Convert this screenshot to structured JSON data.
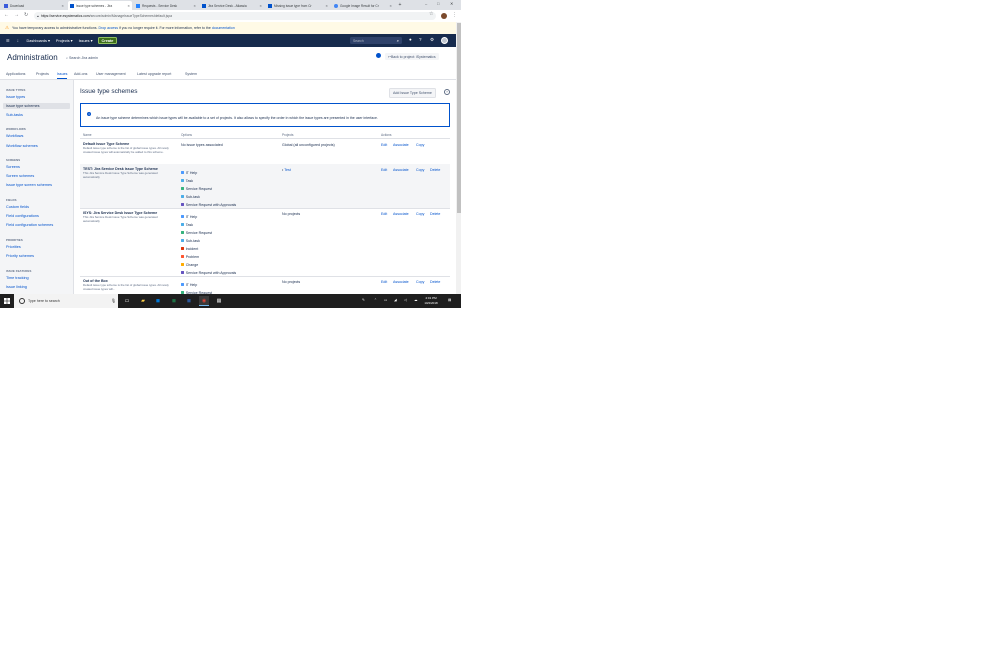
{
  "browser": {
    "tabs": [
      {
        "title": "Download",
        "color": "#3b5bdb",
        "active": false
      },
      {
        "title": "Issue type schemes - Jira",
        "color": "#0052cc",
        "active": true
      },
      {
        "title": "Requests - Service Desk",
        "color": "#2684ff",
        "active": false
      },
      {
        "title": "Jira Service Desk - Atlassia",
        "color": "#0052cc",
        "active": false
      },
      {
        "title": "Missing issue type from Cr",
        "color": "#0052cc",
        "active": false
      },
      {
        "title": "Google Image Result for Cr",
        "color": "#4285f4",
        "active": false
      }
    ],
    "url_host": "https://service.esystematics.com",
    "url_path": "/secure/admin/ManageIssueTypeSchemes!default.jspa"
  },
  "banner": {
    "text1": "You have temporary access to administrative functions.",
    "drop_link": "Drop access",
    "text2": "if you no longer require it. For more information, refer to the",
    "doc_link": "documentation"
  },
  "topnav": {
    "dashboards": "Dashboards ▾",
    "projects": "Projects ▾",
    "issues": "Issues ▾",
    "create": "Create",
    "search_placeholder": "Search"
  },
  "admin": {
    "title": "Administration",
    "search": "Search Jira admin",
    "back": "Back to project: iSystematics",
    "tabs": [
      "Applications",
      "Projects",
      "Issues",
      "Add-ons",
      "User management",
      "Latest upgrade report",
      "System"
    ]
  },
  "sidebar": {
    "sections": [
      {
        "heading": "ISSUE TYPES",
        "items": [
          "Issue types",
          "Issue type schemes",
          "Sub-tasks"
        ]
      },
      {
        "heading": "WORKFLOWS",
        "items": [
          "Workflows",
          "Workflow schemes"
        ]
      },
      {
        "heading": "SCREENS",
        "items": [
          "Screens",
          "Screen schemes",
          "Issue type screen schemes"
        ]
      },
      {
        "heading": "FIELDS",
        "items": [
          "Custom fields",
          "Field configurations",
          "Field configuration schemes"
        ]
      },
      {
        "heading": "PRIORITIES",
        "items": [
          "Priorities",
          "Priority schemes"
        ]
      },
      {
        "heading": "ISSUE FEATURES",
        "items": [
          "Time tracking",
          "Issue linking"
        ]
      }
    ]
  },
  "main": {
    "title": "Issue type schemes",
    "add_button": "Add Issue Type Scheme",
    "info": "An issue type scheme determines which issue types will be available to a set of projects. It also allows to specify the order in which the issue types are presented in the user interface.",
    "columns": [
      "Name",
      "Options",
      "Projects",
      "Actions"
    ],
    "schemes": [
      {
        "name": "Default Issue Type Scheme",
        "desc": "Default issue type scheme is the list of global issue types. All newly created issue types will automatically be added to this scheme.",
        "options_text": "No issue types associated",
        "options": [],
        "projects_text": "Global (all unconfigured projects)",
        "actions": [
          "Edit",
          "Associate",
          "Copy"
        ]
      },
      {
        "name": "TEST: Jira Service Desk Issue Type Scheme",
        "desc": "This Jira Service Desk Issue Type Scheme was generated automatically",
        "options_text": "",
        "options": [
          {
            "label": "IT Help",
            "color": "#4c9aff"
          },
          {
            "label": "Task",
            "color": "#4bade8"
          },
          {
            "label": "Service Request",
            "color": "#36b37e"
          },
          {
            "label": "Sub-task",
            "color": "#4bade8"
          },
          {
            "label": "Service Request with Approvals",
            "color": "#6554c0"
          }
        ],
        "projects_text": "",
        "project_link": "Test",
        "actions": [
          "Edit",
          "Associate",
          "Copy",
          "Delete"
        ]
      },
      {
        "name": "ISYS: Jira Service Desk Issue Type Scheme",
        "desc": "This Jira Service Desk Issue Type Scheme was generated automatically",
        "options_text": "",
        "options": [
          {
            "label": "IT Help",
            "color": "#4c9aff"
          },
          {
            "label": "Task",
            "color": "#4bade8"
          },
          {
            "label": "Service Request",
            "color": "#36b37e"
          },
          {
            "label": "Sub-task",
            "color": "#4bade8"
          },
          {
            "label": "Incident",
            "color": "#de350b"
          },
          {
            "label": "Problem",
            "color": "#ff5630"
          },
          {
            "label": "Change",
            "color": "#ffab00"
          },
          {
            "label": "Service Request with Approvals",
            "color": "#6554c0"
          }
        ],
        "projects_text": "No projects",
        "actions": [
          "Edit",
          "Associate",
          "Copy",
          "Delete"
        ]
      },
      {
        "name": "Out of the Box",
        "desc": "Default issue type scheme is the list of global issue types. All newly created issue types will...",
        "options_text": "",
        "options": [
          {
            "label": "IT Help",
            "color": "#4c9aff"
          },
          {
            "label": "Service Request",
            "color": "#36b37e"
          }
        ],
        "projects_text": "No projects",
        "actions": [
          "Edit",
          "Associate",
          "Copy",
          "Delete"
        ]
      }
    ]
  },
  "taskbar": {
    "search_placeholder": "Type here to search",
    "time": "4:01 PM",
    "date": "10/2/2018"
  }
}
